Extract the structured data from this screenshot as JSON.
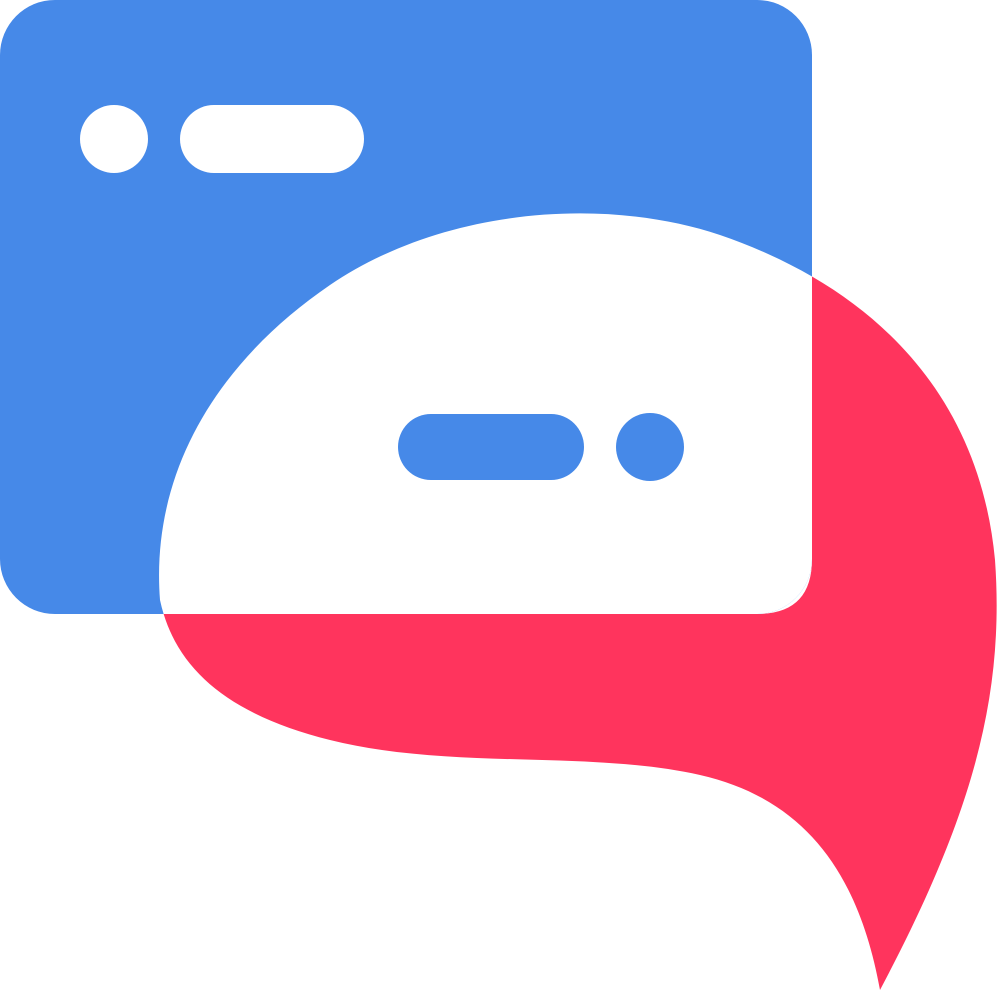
{
  "logo": {
    "name": "chat-window-logo",
    "colors": {
      "window_blue": "#4689E8",
      "bubble_red": "#FF345D",
      "bubble_white": "#FFFFFF",
      "background": "#FFFFFF"
    },
    "icons": [
      "browser-window-icon",
      "speech-bubble-icon"
    ]
  }
}
